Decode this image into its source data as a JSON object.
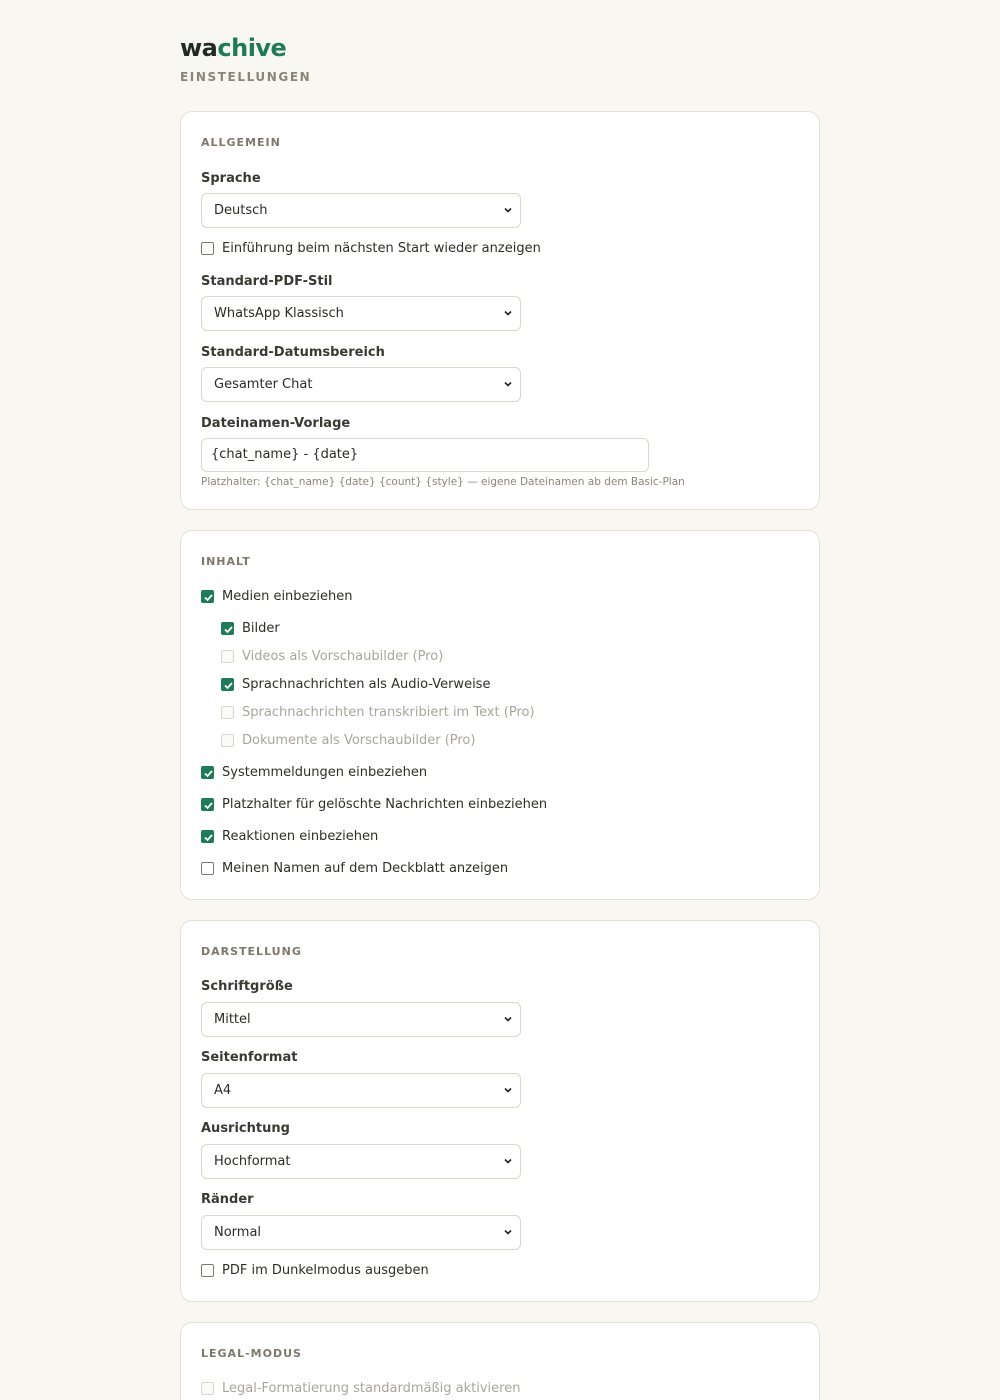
{
  "app": {
    "brand_part1": "wa",
    "brand_part2": "chive",
    "subtitle": "EINSTELLUNGEN"
  },
  "accent_color": "#1e7a57",
  "allgemein": {
    "title": "ALLGEMEIN",
    "language_label": "Sprache",
    "language_value": "Deutsch",
    "intro_checkbox": {
      "label": "Einführung beim nächsten Start wieder anzeigen",
      "checked": false
    },
    "pdf_style_label": "Standard-PDF-Stil",
    "pdf_style_value": "WhatsApp Klassisch",
    "date_range_label": "Standard-Datumsbereich",
    "date_range_value": "Gesamter Chat",
    "filename_label": "Dateinamen-Vorlage",
    "filename_value": "{chat_name} - {date}",
    "filename_hint": "Platzhalter: {chat_name} {date} {count} {style} — eigene Dateinamen ab dem Basic-Plan"
  },
  "inhalt": {
    "title": "INHALT",
    "media": {
      "label": "Medien einbeziehen",
      "checked": true
    },
    "images": {
      "label": "Bilder",
      "checked": true
    },
    "videos": {
      "label": "Videos als Vorschaubilder (Pro)",
      "checked": false,
      "disabled": true
    },
    "voice_audio": {
      "label": "Sprachnachrichten als Audio-Verweise",
      "checked": true
    },
    "voice_transcribed": {
      "label": "Sprachnachrichten transkribiert im Text (Pro)",
      "checked": false,
      "disabled": true
    },
    "documents": {
      "label": "Dokumente als Vorschaubilder (Pro)",
      "checked": false,
      "disabled": true
    },
    "system_messages": {
      "label": "Systemmeldungen einbeziehen",
      "checked": true
    },
    "deleted_placeholder": {
      "label": "Platzhalter für gelöschte Nachrichten einbeziehen",
      "checked": true
    },
    "reactions": {
      "label": "Reaktionen einbeziehen",
      "checked": true
    },
    "my_name_cover": {
      "label": "Meinen Namen auf dem Deckblatt anzeigen",
      "checked": false
    }
  },
  "darstellung": {
    "title": "DARSTELLUNG",
    "font_size_label": "Schriftgröße",
    "font_size_value": "Mittel",
    "page_format_label": "Seitenformat",
    "page_format_value": "A4",
    "orientation_label": "Ausrichtung",
    "orientation_value": "Hochformat",
    "margins_label": "Ränder",
    "margins_value": "Normal",
    "dark_pdf": {
      "label": "PDF im Dunkelmodus ausgeben",
      "checked": false
    }
  },
  "legal": {
    "title": "LEGAL-MODUS",
    "legal_default": {
      "label": "Legal-Formatierung standardmäßig aktivieren",
      "checked": false,
      "disabled": true
    }
  }
}
